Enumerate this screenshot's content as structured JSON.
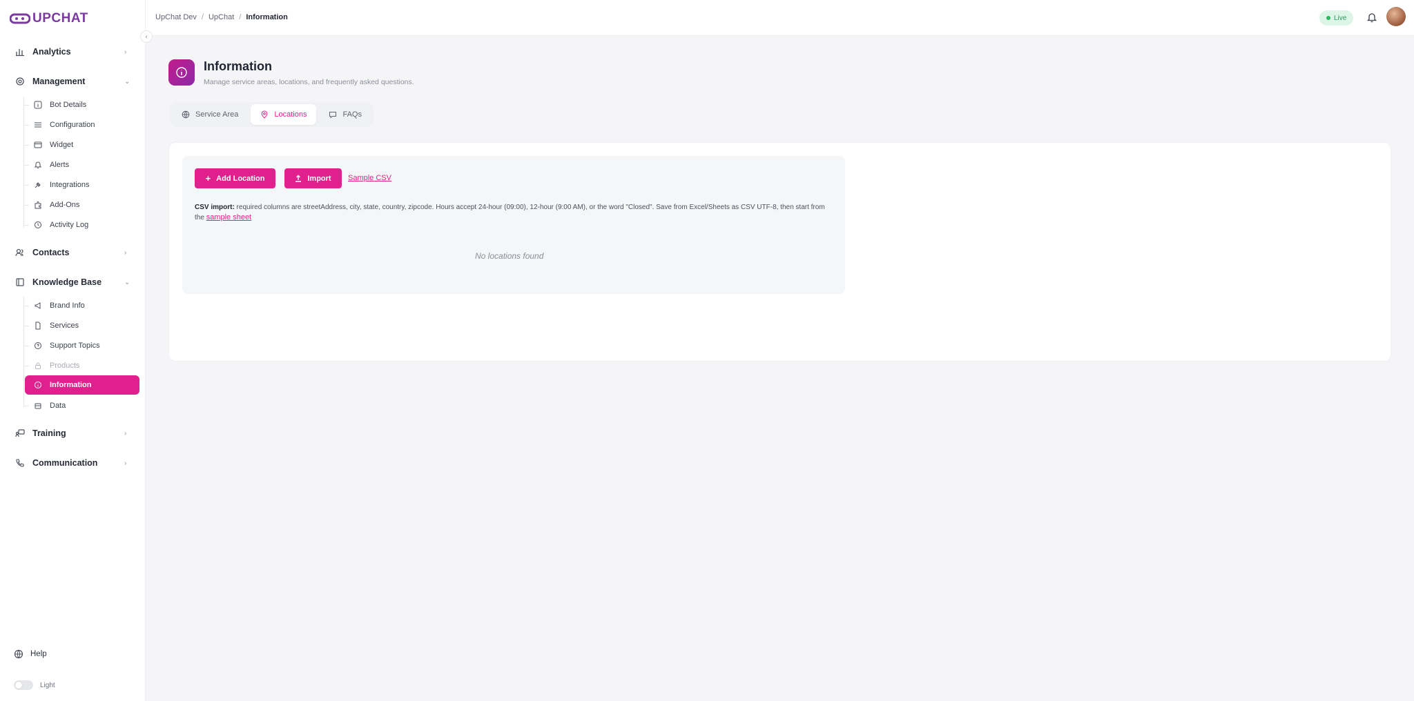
{
  "app": {
    "logo_text": "UPCHAT"
  },
  "breadcrumb": {
    "items": [
      "UpChat Dev",
      "UpChat"
    ],
    "current": "Information"
  },
  "topbar": {
    "live_label": "Live"
  },
  "sidebar": {
    "groups": {
      "analytics": "Analytics",
      "management": "Management",
      "contacts": "Contacts",
      "knowledge_base": "Knowledge Base",
      "training": "Training",
      "communication": "Communication"
    },
    "management_items": [
      "Bot Details",
      "Configuration",
      "Widget",
      "Alerts",
      "Integrations",
      "Add-Ons",
      "Activity Log"
    ],
    "kb_items": [
      "Brand Info",
      "Services",
      "Support Topics",
      "Products",
      "Information",
      "Data"
    ],
    "help": "Help",
    "theme": "Light"
  },
  "page": {
    "title": "Information",
    "subtitle": "Manage service areas, locations, and frequently asked questions."
  },
  "tabs": [
    "Service Area",
    "Locations",
    "FAQs"
  ],
  "locations": {
    "add_button": "Add Location",
    "import_button": "Import",
    "sample_csv": "Sample CSV",
    "note_bold": "CSV import:",
    "note_text": " required columns are streetAddress, city, state, country, zipcode. Hours accept 24-hour (09:00), 12-hour (9:00 AM), or the word \"Closed\". Save from Excel/Sheets as CSV UTF-8, then start from the ",
    "note_link": "sample sheet",
    "empty": "No locations found"
  },
  "colors": {
    "accent": "#e0208d",
    "brand": "#7b3aa0",
    "live_bg": "#dcf5e6"
  }
}
